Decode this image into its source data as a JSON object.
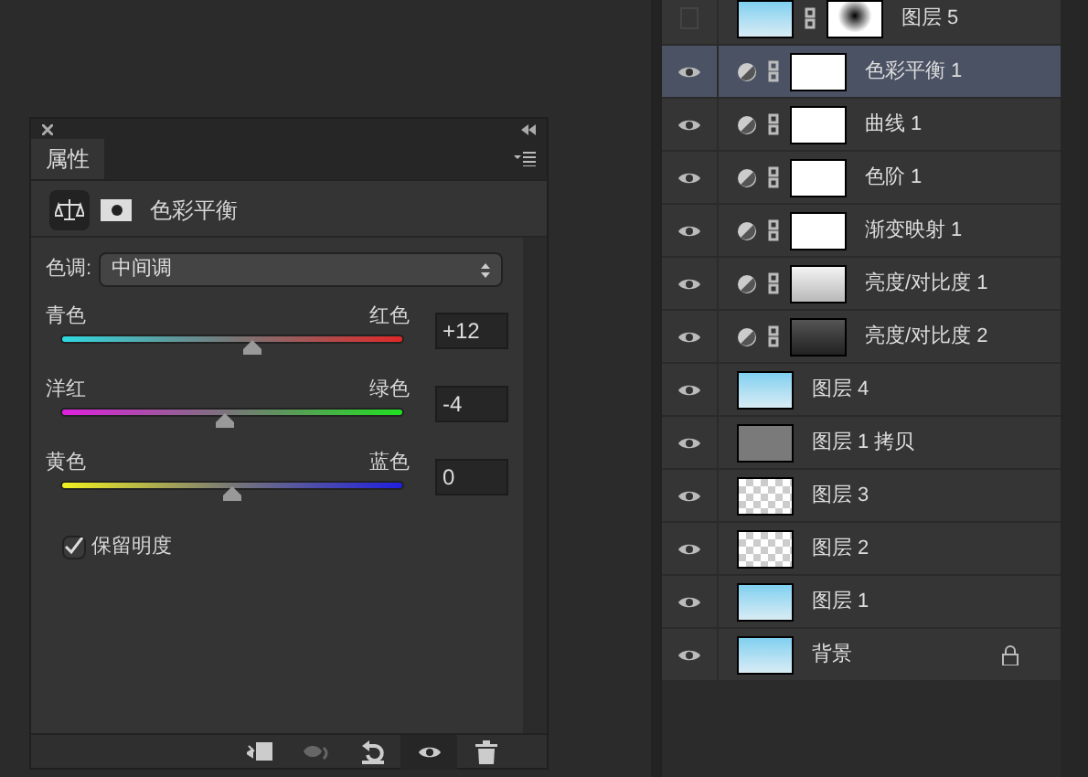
{
  "properties": {
    "tab": "属性",
    "adjustment": "色彩平衡",
    "tone_label": "色调:",
    "tone_value": "中间调",
    "sliders": [
      {
        "left": "青色",
        "right": "红色",
        "value": "+12",
        "level": 0.56
      },
      {
        "left": "洋红",
        "right": "绿色",
        "value": "-4",
        "level": 0.48
      },
      {
        "left": "黄色",
        "right": "蓝色",
        "value": "0",
        "level": 0.5
      }
    ],
    "preserve": {
      "label": "保留明度",
      "checked": true
    },
    "toolbar": [
      {
        "kind": "clip",
        "disabled": false
      },
      {
        "kind": "preview",
        "disabled": true
      },
      {
        "kind": "reset",
        "disabled": false
      },
      {
        "kind": "eye",
        "disabled": false
      },
      {
        "kind": "trash",
        "disabled": false
      }
    ]
  },
  "layers": [
    {
      "name": "图层 5",
      "kind": "pixel",
      "thumb": {
        "kind": "photo"
      },
      "mask": {
        "kind": "spot"
      },
      "visible": false,
      "selected": false,
      "locked": false
    },
    {
      "name": "色彩平衡 1",
      "kind": "adjustment",
      "mask": {
        "kind": "white"
      },
      "visible": true,
      "selected": true,
      "locked": false
    },
    {
      "name": "曲线 1",
      "kind": "adjustment",
      "mask": {
        "kind": "white"
      },
      "visible": true,
      "selected": false,
      "locked": false
    },
    {
      "name": "色阶 1",
      "kind": "adjustment",
      "mask": {
        "kind": "white"
      },
      "visible": true,
      "selected": false,
      "locked": false
    },
    {
      "name": "渐变映射 1",
      "kind": "adjustment",
      "mask": {
        "kind": "white"
      },
      "visible": true,
      "selected": false,
      "locked": false
    },
    {
      "name": "亮度/对比度 1",
      "kind": "adjustment",
      "mask": {
        "kind": "light"
      },
      "visible": true,
      "selected": false,
      "locked": false
    },
    {
      "name": "亮度/对比度 2",
      "kind": "adjustment",
      "mask": {
        "kind": "dark"
      },
      "visible": true,
      "selected": false,
      "locked": false
    },
    {
      "name": "图层 4",
      "kind": "pixel",
      "thumb": {
        "kind": "photo"
      },
      "visible": true,
      "selected": false,
      "locked": false
    },
    {
      "name": "图层 1 拷贝",
      "kind": "pixel",
      "thumb": {
        "kind": "gray"
      },
      "visible": true,
      "selected": false,
      "locked": false
    },
    {
      "name": "图层 3",
      "kind": "pixel",
      "thumb": {
        "kind": "transparent"
      },
      "visible": true,
      "selected": false,
      "locked": false
    },
    {
      "name": "图层 2",
      "kind": "pixel",
      "thumb": {
        "kind": "transparent"
      },
      "visible": true,
      "selected": false,
      "locked": false
    },
    {
      "name": "图层 1",
      "kind": "pixel",
      "thumb": {
        "kind": "photo"
      },
      "visible": true,
      "selected": false,
      "locked": false
    },
    {
      "name": "背景",
      "kind": "pixel",
      "thumb": {
        "kind": "photo"
      },
      "visible": true,
      "selected": false,
      "locked": true
    }
  ]
}
